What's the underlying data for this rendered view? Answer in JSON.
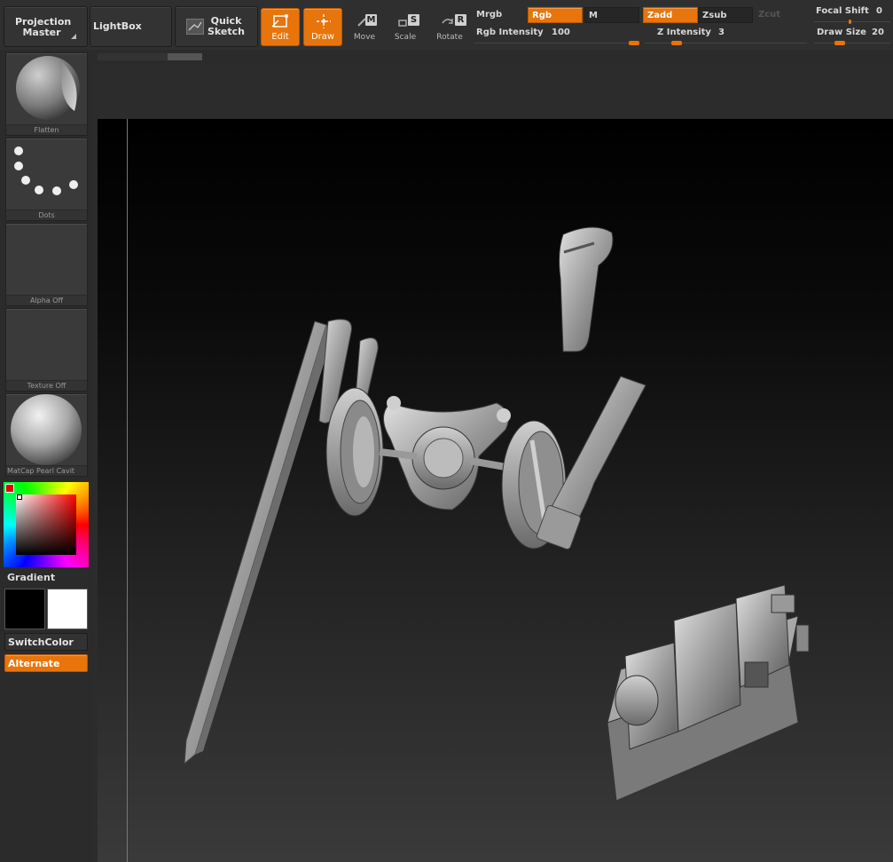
{
  "toolbar": {
    "projection_master": "Projection Master",
    "lightbox": "LightBox",
    "quick_sketch": "Quick Sketch",
    "edit": "Edit",
    "draw": "Draw",
    "move": "Move",
    "scale": "Scale",
    "rotate": "Rotate",
    "move_key": "M",
    "scale_key": "S",
    "rotate_key": "R"
  },
  "modes": {
    "mrgb": "Mrgb",
    "rgb": "Rgb",
    "m": "M",
    "zadd": "Zadd",
    "zsub": "Zsub",
    "zcut": "Zcut"
  },
  "sliders": {
    "rgb_intensity_label": "Rgb Intensity",
    "rgb_intensity": 100,
    "z_intensity_label": "Z Intensity",
    "z_intensity": 3,
    "focal_shift_label": "Focal Shift",
    "focal_shift": 0,
    "draw_size_label": "Draw Size",
    "draw_size": 20
  },
  "left_panel": {
    "brush": "Flatten",
    "stroke": "Dots",
    "alpha": "Alpha Off",
    "texture": "Texture Off",
    "material": "MatCap Pearl Cavit",
    "gradient": "Gradient",
    "switch_color": "SwitchColor",
    "alternate": "Alternate"
  },
  "colors": {
    "accent": "#e8740c",
    "primary_color": "#000000",
    "secondary_color": "#ffffff"
  }
}
